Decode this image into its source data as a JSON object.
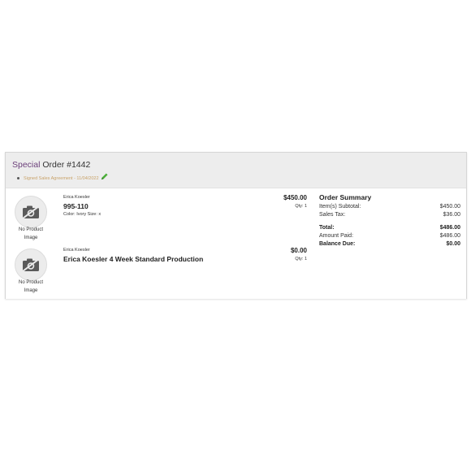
{
  "order": {
    "title_prefix": "Special",
    "title_rest": " Order #1442",
    "agreement_link": "Signed Sales Agreement - 11/04/2022"
  },
  "items": [
    {
      "no_image_line1": "No Product",
      "no_image_line2": "Image",
      "brand": "Erica Koesler",
      "name": "995-110",
      "variant": "Color: Ivory Size: x",
      "price": "$450.00",
      "qty": "Qty: 1"
    },
    {
      "no_image_line1": "No Product",
      "no_image_line2": "Image",
      "brand": "Erica Koesler",
      "name": "Erica Koesler 4 Week Standard Production",
      "variant": "",
      "price": "$0.00",
      "qty": "Qty: 1"
    }
  ],
  "summary": {
    "title": "Order Summary",
    "subtotal_label": "Item(s) Subtotal:",
    "subtotal_value": "$450.00",
    "tax_label": "Sales Tax:",
    "tax_value": "$36.00",
    "total_label": "Total:",
    "total_value": "$486.00",
    "paid_label": "Amount Paid:",
    "paid_value": "$486.00",
    "due_label": "Balance Due:",
    "due_value": "$0.00"
  },
  "colors": {
    "header_bg": "#ededed",
    "special_text": "#6b3f7a",
    "agreement_link": "#c9a36a",
    "pencil_icon": "#4caf3a"
  },
  "icons": {
    "agreement_edit": "pencil-icon",
    "product_placeholder": "no-image-icon"
  }
}
